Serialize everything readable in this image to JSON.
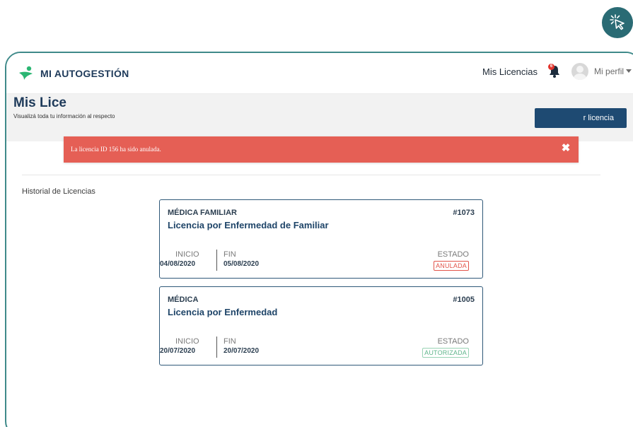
{
  "app": {
    "brand": "MI AUTOGESTIÓN",
    "brand_color": "#2bb673"
  },
  "nav": {
    "licencias_link": "Mis Licencias",
    "notification_count": "6",
    "profile_label": "Mi perfil"
  },
  "page": {
    "title": "Mis Lice",
    "subtitle": "Visualizá toda tu información al respecto",
    "new_button": "r licencia"
  },
  "toast": {
    "message": "La licencia ID 156 ha sido anulada.",
    "close_glyph": "✖",
    "color": "#e55f55"
  },
  "history": {
    "label": "Historial de Licencias",
    "cards": [
      {
        "type": "MÉDICA FAMILIAR",
        "id": "#1073",
        "title": "Licencia por Enfermedad de Familiar",
        "inicio_label": "INICIO",
        "inicio": "04/08/2020",
        "fin_label": "FIN",
        "fin": "05/08/2020",
        "estado_label": "ESTADO",
        "estado": "ANULADA"
      },
      {
        "type": "MÉDICA",
        "id": "#1005",
        "title": "Licencia por Enfermedad",
        "inicio_label": "INICIO",
        "inicio": "20/07/2020",
        "fin_label": "FIN",
        "fin": "20/07/2020",
        "estado_label": "ESTADO",
        "estado": "AUTORIZADA"
      }
    ]
  }
}
